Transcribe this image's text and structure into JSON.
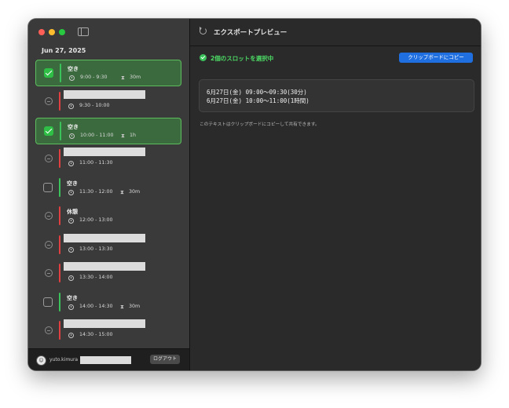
{
  "sidebar": {
    "date_header": "Jun 27, 2025",
    "slots": [
      {
        "kind": "free",
        "selected": true,
        "title": "空き",
        "time": "9:00 - 9:30",
        "duration": "30m"
      },
      {
        "kind": "busy",
        "selected": false,
        "title": "",
        "time": "9:30 - 10:00",
        "duration": ""
      },
      {
        "kind": "free",
        "selected": true,
        "title": "空き",
        "time": "10:00 - 11:00",
        "duration": "1h"
      },
      {
        "kind": "busy",
        "selected": false,
        "title": "",
        "time": "11:00 - 11:30",
        "duration": ""
      },
      {
        "kind": "free",
        "selected": false,
        "title": "空き",
        "time": "11:30 - 12:00",
        "duration": "30m"
      },
      {
        "kind": "busy",
        "selected": false,
        "title": "休憩",
        "time": "12:00 - 13:00",
        "duration": ""
      },
      {
        "kind": "busy",
        "selected": false,
        "title": "",
        "time": "13:00 - 13:30",
        "duration": ""
      },
      {
        "kind": "busy",
        "selected": false,
        "title": "",
        "time": "13:30 - 14:00",
        "duration": ""
      },
      {
        "kind": "free",
        "selected": false,
        "title": "空き",
        "time": "14:00 - 14:30",
        "duration": "30m"
      },
      {
        "kind": "busy",
        "selected": false,
        "title": "",
        "time": "14:30 - 15:00",
        "duration": ""
      }
    ],
    "footer": {
      "username": "yuto.kimura",
      "logout_label": "ログアウト"
    }
  },
  "main": {
    "title": "エクスポートプレビュー",
    "status_text": "2個のスロットを選択中",
    "copy_button_label": "クリップボードにコピー",
    "preview_lines": [
      "6月27日(金) 09:00〜09:30(30分)",
      "6月27日(金) 10:00〜11:00(1時間)"
    ],
    "hint": "このテキストはクリップボードにコピーして共有できます。"
  },
  "colors": {
    "free_bar": "#3bc25a",
    "busy_bar": "#e04040",
    "selected_bg": "#3c6a3f",
    "accent_button": "#1f6fe0",
    "status_green": "#4cd964"
  }
}
